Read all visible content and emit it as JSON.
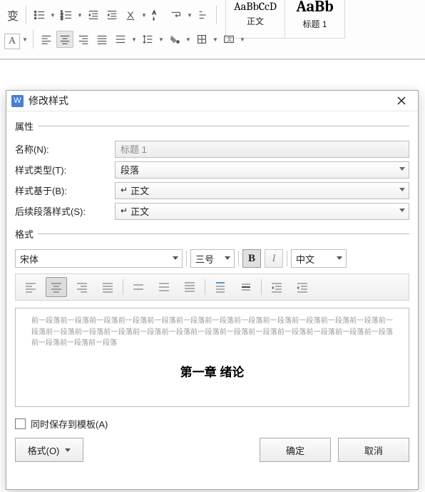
{
  "ribbon": {
    "style_boxes": [
      {
        "preview": "AaBbCcD",
        "label": "正文",
        "prev_size": "16px",
        "prev_weight": "400"
      },
      {
        "preview": "AaBb",
        "label": "标题 1",
        "prev_size": "22px",
        "prev_weight": "700"
      }
    ],
    "char_box": "A"
  },
  "dialog": {
    "title": "修改样式",
    "w_icon": "W",
    "sec_attr": "属性",
    "sec_fmt": "格式",
    "lbl_name": "名称(N):",
    "lbl_type": "样式类型(T):",
    "lbl_based": "样式基于(B):",
    "lbl_follow": "后续段落样式(S):",
    "val_name": "标题 1",
    "val_type": "段落",
    "val_based": "正文",
    "val_follow": "正文",
    "font": "宋体",
    "size": "三号",
    "bold": "B",
    "italic": "I",
    "script": "中文",
    "preview_text": "前一段落前一段落前一段落前一段落前一段落前一段落前一段落前一段落前一段落前一段落前一段落前一段落前一段落前一段落前一段落前一段落前一段落前一段落前一段落前一段落前一段落前一段落前一段落前一段落前一段落前一段落前一段落前一段落",
    "chapter": "第一章  绪论",
    "save_tmpl": "同时保存到模板(A)",
    "btn_format": "格式(O)",
    "btn_ok": "确定",
    "btn_cancel": "取消"
  }
}
